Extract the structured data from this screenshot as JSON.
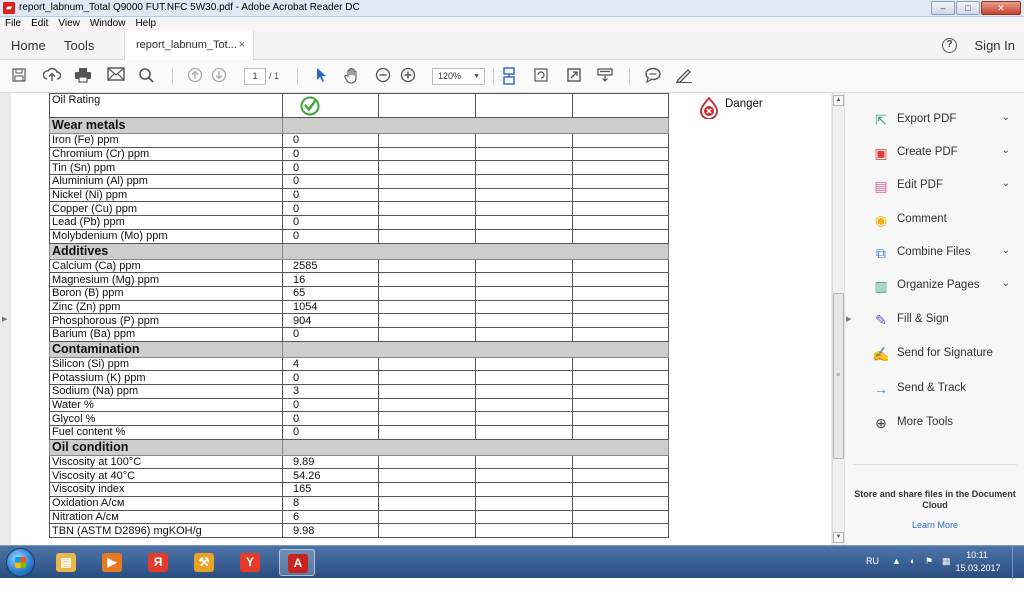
{
  "window": {
    "title": "report_labnum_Total Q9000 FUT.NFC 5W30.pdf - Adobe Acrobat Reader DC",
    "app_icon": "pdf-icon",
    "minimize": "–",
    "maximize": "□",
    "close": "✕"
  },
  "menu": [
    "File",
    "Edit",
    "View",
    "Window",
    "Help"
  ],
  "tabs": {
    "home": "Home",
    "tools": "Tools",
    "document": "report_labnum_Tot...",
    "close": "×",
    "help": "?",
    "sign_in": "Sign In"
  },
  "toolbar": {
    "page_current": "1",
    "page_total": "/ 1",
    "zoom": "120%",
    "zoom_arrow": "▼"
  },
  "report": {
    "rating_label": "Oil Rating",
    "danger_label": "Danger",
    "sections": [
      {
        "title": "Wear metals",
        "rows": [
          {
            "label": "Iron (Fe) ppm",
            "value": "0"
          },
          {
            "label": "Chromium (Cr) ppm",
            "value": "0"
          },
          {
            "label": "Tin (Sn) ppm",
            "value": "0"
          },
          {
            "label": "Aluminium (Al) ppm",
            "value": "0"
          },
          {
            "label": "Nickel (Ni) ppm",
            "value": "0"
          },
          {
            "label": "Copper (Cu) ppm",
            "value": "0"
          },
          {
            "label": "Lead (Pb) ppm",
            "value": "0"
          },
          {
            "label": "Molybdenium (Mo) ppm",
            "value": "0"
          }
        ]
      },
      {
        "title": "Additives",
        "rows": [
          {
            "label": "Calcium (Ca) ppm",
            "value": "2585"
          },
          {
            "label": "Magnesium (Mg) ppm",
            "value": "16"
          },
          {
            "label": "Boron (B) ppm",
            "value": "65"
          },
          {
            "label": "Zinc (Zn) ppm",
            "value": "1054"
          },
          {
            "label": "Phosphorous (P) ppm",
            "value": "904"
          },
          {
            "label": "Barium (Ba) ppm",
            "value": "0"
          }
        ]
      },
      {
        "title": "Contamination",
        "rows": [
          {
            "label": "Silicon (Si) ppm",
            "value": "4"
          },
          {
            "label": "Potassium (K) ppm",
            "value": "0"
          },
          {
            "label": "Sodium (Na) ppm",
            "value": "3"
          },
          {
            "label": "Water %",
            "value": "0"
          },
          {
            "label": "Glycol %",
            "value": "0"
          },
          {
            "label": "Fuel content %",
            "value": "0"
          }
        ]
      },
      {
        "title": "Oil condition",
        "rows": [
          {
            "label": "Viscosity at 100°C",
            "value": "9.89"
          },
          {
            "label": "Viscosity at 40°C",
            "value": "54.26"
          },
          {
            "label": "Viscosity index",
            "value": "165"
          },
          {
            "label": "Oxidation A/см",
            "value": "8"
          },
          {
            "label": "Nitration A/см",
            "value": "6"
          },
          {
            "label": "TBN (ASTM D2896) mgKOH/g",
            "value": "9.98"
          }
        ]
      }
    ]
  },
  "tools_panel": {
    "items": [
      {
        "label": "Export PDF",
        "icon": "export-pdf-icon",
        "color": "#3fa373",
        "has_menu": true
      },
      {
        "label": "Create PDF",
        "icon": "create-pdf-icon",
        "color": "#e2403c",
        "has_menu": true
      },
      {
        "label": "Edit PDF",
        "icon": "edit-pdf-icon",
        "color": "#e65a9b",
        "has_menu": true
      },
      {
        "label": "Comment",
        "icon": "comment-icon",
        "color": "#f2b21b",
        "has_menu": false
      },
      {
        "label": "Combine Files",
        "icon": "combine-files-icon",
        "color": "#3d7fd3",
        "has_menu": true
      },
      {
        "label": "Organize Pages",
        "icon": "organize-pages-icon",
        "color": "#3fa373",
        "has_menu": true
      },
      {
        "label": "Fill & Sign",
        "icon": "fill-sign-icon",
        "color": "#6c52c7",
        "has_menu": false
      },
      {
        "label": "Send for Signature",
        "icon": "send-signature-icon",
        "color": "#6c52c7",
        "has_menu": false
      },
      {
        "label": "Send & Track",
        "icon": "send-track-icon",
        "color": "#3d7fd3",
        "has_menu": false
      },
      {
        "label": "More Tools",
        "icon": "more-tools-icon",
        "color": "#444444",
        "has_menu": false
      }
    ],
    "cloud_text": "Store and share files in the Document Cloud",
    "learn_more": "Learn More"
  },
  "taskbar": {
    "language": "RU",
    "time": "10:11",
    "date": "15.03.2017",
    "apps": [
      {
        "name": "file-explorer-icon",
        "color": "#e8b94a",
        "glyph": "▤"
      },
      {
        "name": "media-player-icon",
        "color": "#e57a21",
        "glyph": "▶"
      },
      {
        "name": "yandex-icon",
        "color": "#e63a2a",
        "glyph": "Я"
      },
      {
        "name": "firewall-icon",
        "color": "#e8a326",
        "glyph": "⚒"
      },
      {
        "name": "yandex-browser-icon",
        "color": "#e63a2a",
        "glyph": "Y"
      },
      {
        "name": "acrobat-icon",
        "color": "#c8231c",
        "glyph": "A"
      }
    ]
  },
  "colors": {
    "accent": "#2d6ec6",
    "check": "#3aa837",
    "danger": "#c7252a",
    "section_fill": "#cdcdcd"
  }
}
